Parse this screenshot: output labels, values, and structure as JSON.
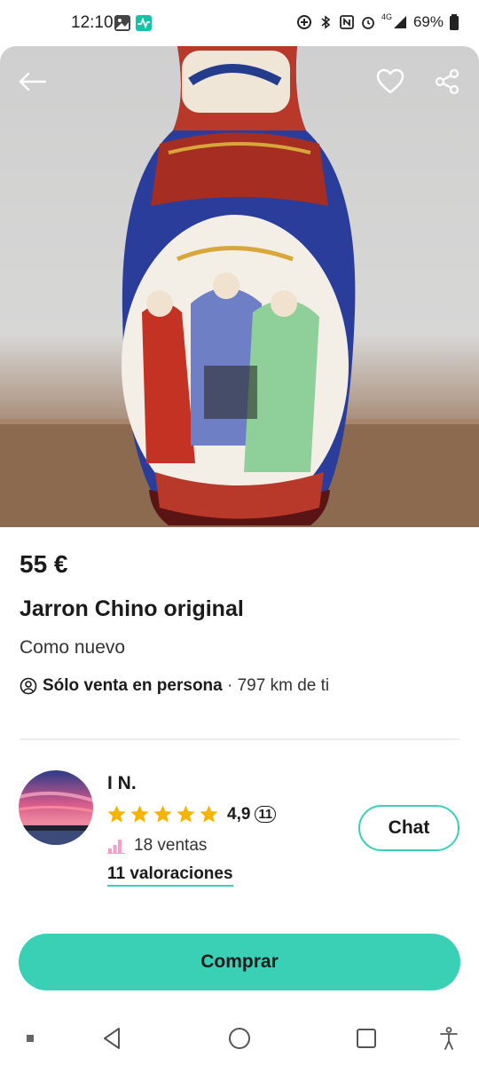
{
  "status_bar": {
    "time": "12:10",
    "network": "4G",
    "battery": "69%"
  },
  "hero": {
    "back_icon": "arrow-left-icon",
    "favorite_icon": "heart-icon",
    "share_icon": "share-icon"
  },
  "item": {
    "price": "55 €",
    "title": "Jarron Chino original",
    "condition": "Como nuevo",
    "delivery_bold": "Sólo venta en persona",
    "delivery_distance": " · 797 km de ti"
  },
  "seller": {
    "name": "I N.",
    "rating": "4,9",
    "rating_count": "11",
    "sales": "18 ventas",
    "reviews_link": "11 valoraciones",
    "chat_label": "Chat"
  },
  "actions": {
    "buy_label": "Comprar"
  },
  "colors": {
    "accent": "#39d0b6",
    "star": "#f5b400"
  }
}
